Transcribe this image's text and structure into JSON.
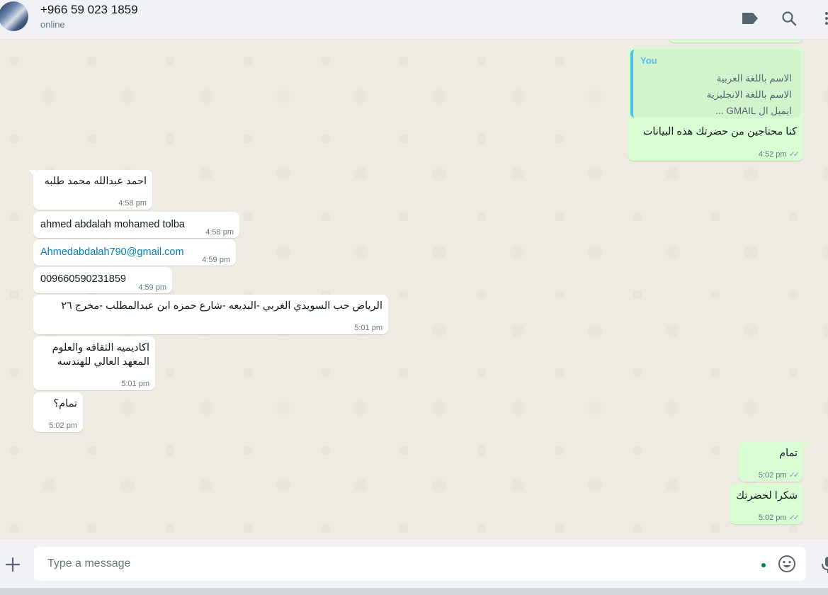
{
  "header": {
    "contact_name": "+966 59 023 1859",
    "contact_status": "online",
    "icons": [
      "label-icon",
      "search-icon",
      "menu-icon"
    ]
  },
  "messages": [
    {
      "direction": "out",
      "quote": {
        "author": "You",
        "lines": [
          "الاسم باللغة العربية",
          "الاسم باللغة الانجليزية",
          "ايميل ال GMAIL ..."
        ]
      },
      "text": "كنا محتاجين من حضرتك هذه البيانات",
      "time": "4:52 pm"
    },
    {
      "direction": "in",
      "text": "احمد عبدالله محمد طلبه",
      "time": "4:58 pm"
    },
    {
      "direction": "in",
      "text": "ahmed abdalah mohamed tolba",
      "time": "4:58 pm"
    },
    {
      "direction": "in",
      "text": "Ahmedabdalah790@gmail.com",
      "time": "4:59 pm",
      "is_link": true
    },
    {
      "direction": "in",
      "text": "009660590231859",
      "time": "4:59 pm"
    },
    {
      "direction": "in",
      "text": "الرياض حب السويدي الغربي -البديعه -شارع حمزه ابن عبدالمطلب -مخرج ٢٦",
      "time": "5:01 pm"
    },
    {
      "direction": "in",
      "lines": [
        "اكاديميه الثقافه والعلوم",
        "المعهد العالي للهندسه"
      ],
      "time": "5:01 pm"
    },
    {
      "direction": "in",
      "text": "تمام؟",
      "time": "5:02 pm"
    },
    {
      "direction": "out",
      "text": "تمام",
      "time": "5:02 pm"
    },
    {
      "direction": "out",
      "text": "شكرا لحضرتك",
      "time": "5:02 pm"
    }
  ],
  "compose": {
    "placeholder": "Type a message",
    "icons": [
      "plus-icon",
      "emoji-icon",
      "mic-icon"
    ]
  },
  "colors": {
    "chat_background": "#efeae2",
    "incoming_bubble": "#ffffff",
    "outgoing_bubble": "#d9fdd3",
    "quote_accent": "#53bdeb",
    "link": "#027eb5",
    "header_background": "#f0f2f5"
  }
}
